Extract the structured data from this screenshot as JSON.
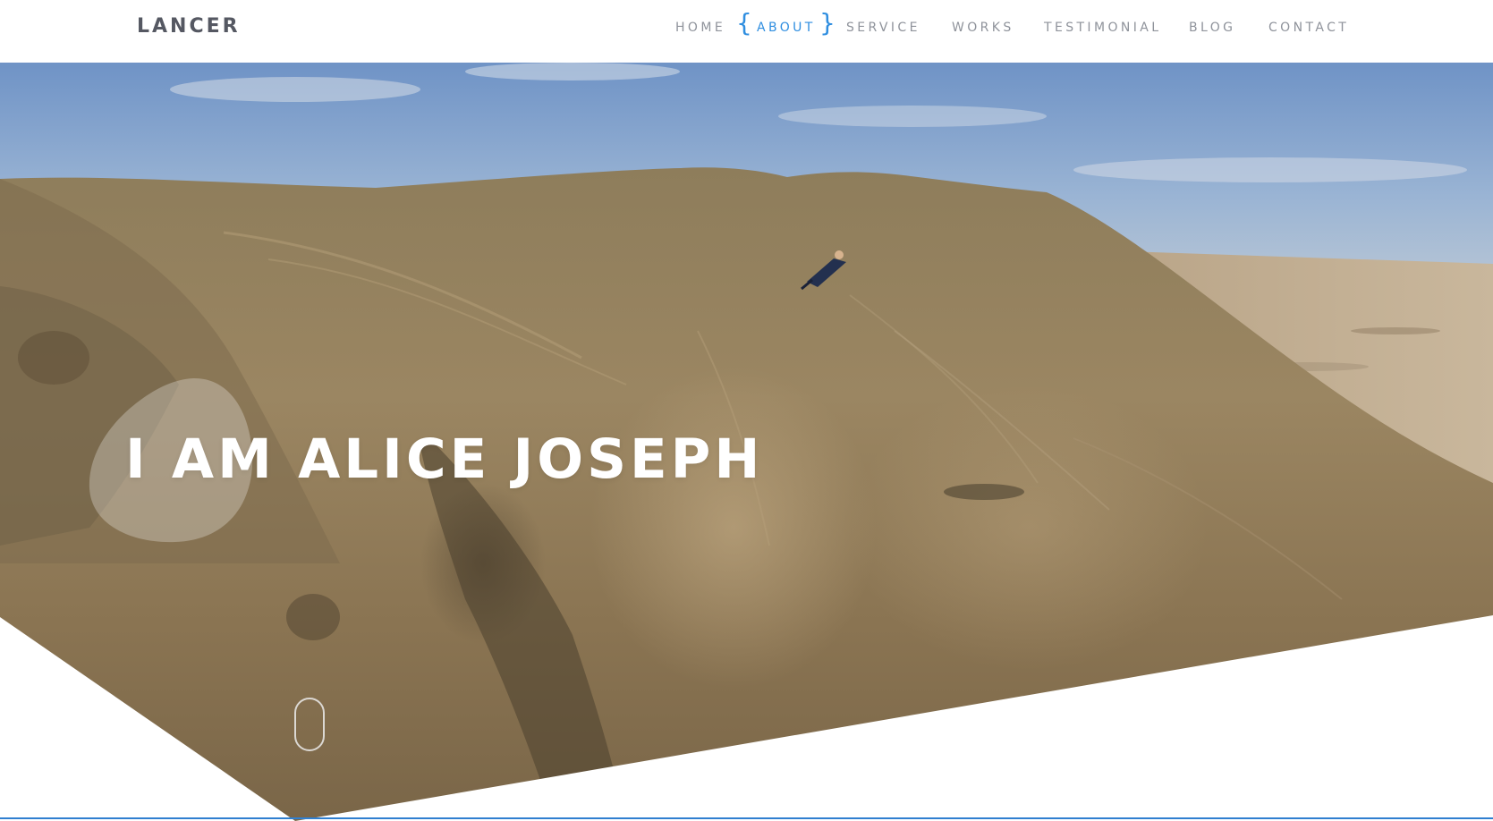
{
  "brand": {
    "name": "LANCER"
  },
  "nav": {
    "items": [
      {
        "label": "HOME",
        "active": false
      },
      {
        "label": "ABOUT",
        "active": true
      },
      {
        "label": "SERVICE",
        "active": false
      },
      {
        "label": "WORKS",
        "active": false
      },
      {
        "label": "TESTIMONIAL",
        "active": false
      },
      {
        "label": "BLOG",
        "active": false
      },
      {
        "label": "CONTACT",
        "active": false
      }
    ],
    "active_brace_left": "{",
    "active_brace_right": "}"
  },
  "hero": {
    "title": "I AM ALICE JOSEPH",
    "background": "aerial photo of a dirt mountain with a motocross rider under a blue sky"
  },
  "colors": {
    "accent": "#2f8ee0",
    "brand_text": "#555862",
    "nav_text": "#8f939b",
    "hero_text": "#ffffff"
  },
  "icons": {
    "scroll_indicator": "mouse-scroll-icon"
  }
}
